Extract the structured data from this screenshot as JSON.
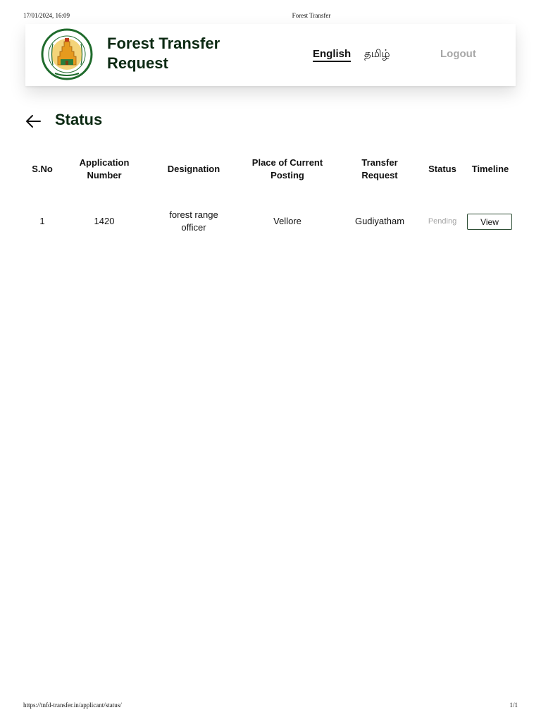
{
  "print_header": {
    "datetime": "17/01/2024, 16:09",
    "doc_title": "Forest Transfer"
  },
  "print_footer": {
    "url": "https://tnfd-transfer.in/applicant/status/",
    "page": "1/1"
  },
  "header": {
    "title_line1": "Forest Transfer",
    "title_line2": "Request",
    "lang_english": "English",
    "lang_tamil": "தமிழ்",
    "logout_label": "Logout"
  },
  "page": {
    "title": "Status"
  },
  "table": {
    "columns": {
      "sno": "S.No",
      "app_no_1": "Application",
      "app_no_2": "Number",
      "designation": "Designation",
      "posting_1": "Place of Current",
      "posting_2": "Posting",
      "transfer_1": "Transfer",
      "transfer_2": "Request",
      "status": "Status",
      "timeline": "Timeline"
    },
    "rows": [
      {
        "sno": "1",
        "application_number": "1420",
        "designation_1": "forest range",
        "designation_2": "officer",
        "current_posting": "Vellore",
        "transfer_request": "Gudiyatham",
        "status": "Pending",
        "action_label": "View"
      }
    ]
  },
  "colors": {
    "brand_dark_green": "#0c2a13",
    "logout_grey": "#a7a7a7",
    "pending_grey": "#a5a5a5",
    "button_border": "#2f4f36"
  }
}
